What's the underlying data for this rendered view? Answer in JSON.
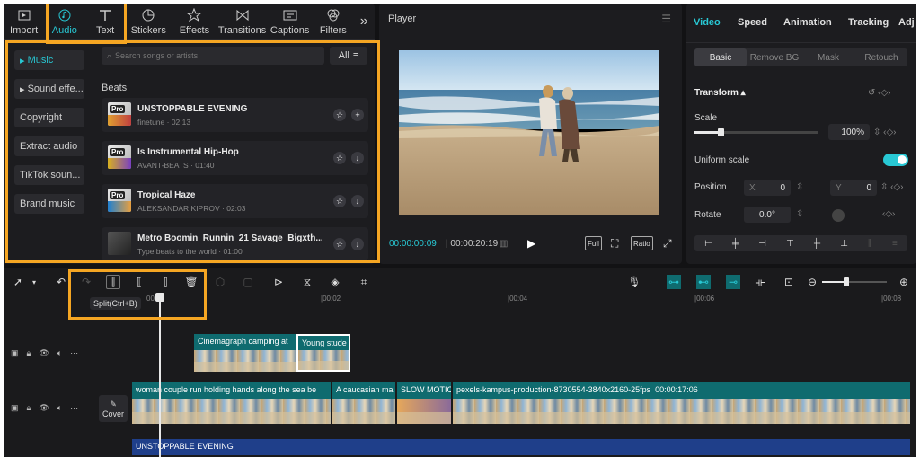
{
  "media_tabs": [
    {
      "label": "Import",
      "icon": "import-icon"
    },
    {
      "label": "Audio",
      "icon": "audio-icon"
    },
    {
      "label": "Text",
      "icon": "text-icon"
    },
    {
      "label": "Stickers",
      "icon": "stickers-icon"
    },
    {
      "label": "Effects",
      "icon": "effects-icon"
    },
    {
      "label": "Transitions",
      "icon": "transitions-icon"
    },
    {
      "label": "Captions",
      "icon": "captions-icon"
    },
    {
      "label": "Filters",
      "icon": "filters-icon"
    }
  ],
  "audio_categories": [
    "Music",
    "Sound effe...",
    "Copyright",
    "Extract audio",
    "TikTok soun...",
    "Brand music"
  ],
  "search": {
    "placeholder": "Search songs or artists",
    "filter_label": "All"
  },
  "section_title": "Beats",
  "tracks": [
    {
      "title": "UNSTOPPABLE EVENING",
      "artist": "finetune",
      "duration": "02:13",
      "badge": "Pro"
    },
    {
      "title": "Is Instrumental Hip-Hop",
      "artist": "AVANT-BEATS",
      "duration": "01:40",
      "badge": "Pro"
    },
    {
      "title": "Tropical Haze",
      "artist": "ALEKSANDAR KIPROV",
      "duration": "02:03",
      "badge": "Pro"
    },
    {
      "title": "Metro Boomin_Runnin_21 Savage_Bigxth...",
      "artist": "Type beats to the world",
      "duration": "01:00",
      "badge": ""
    }
  ],
  "player": {
    "title": "Player",
    "current_time": "00:00:00:09",
    "total_time": "00:00:20:19",
    "full_label": "Full",
    "ratio_label": "Ratio"
  },
  "properties": {
    "tabs": [
      "Video",
      "Speed",
      "Animation",
      "Tracking",
      "Adj"
    ],
    "subtabs": [
      "Basic",
      "Remove BG",
      "Mask",
      "Retouch"
    ],
    "transform_label": "Transform",
    "scale_label": "Scale",
    "scale_value": "100%",
    "uniform_scale_label": "Uniform scale",
    "position_label": "Position",
    "pos_x_label": "X",
    "pos_x": "0",
    "pos_y_label": "Y",
    "pos_y": "0",
    "rotate_label": "Rotate",
    "rotate_value": "0.0°"
  },
  "timeline": {
    "tooltip": "Split(Ctrl+B)",
    "ruler": [
      "00:00",
      "|00:02",
      "|00:04",
      "|00:06",
      "|00:08"
    ],
    "cover_label": "Cover",
    "clips_overlay": [
      {
        "label": "Cinemagraph camping at"
      },
      {
        "label": "Young stude"
      }
    ],
    "clips_main": [
      {
        "label": "woman couple run holding hands along the sea be"
      },
      {
        "label": "A caucasian mal"
      },
      {
        "label": "SLOW MOTIC"
      },
      {
        "label": "pexels-kampus-production-8730554-3840x2160-25fps",
        "duration": "00:00:17:06"
      }
    ],
    "audio_clip": "UNSTOPPABLE EVENING"
  },
  "colors": {
    "accent": "#28c8d4",
    "highlight": "#f5a623",
    "audio_clip": "#1f3f8a"
  }
}
